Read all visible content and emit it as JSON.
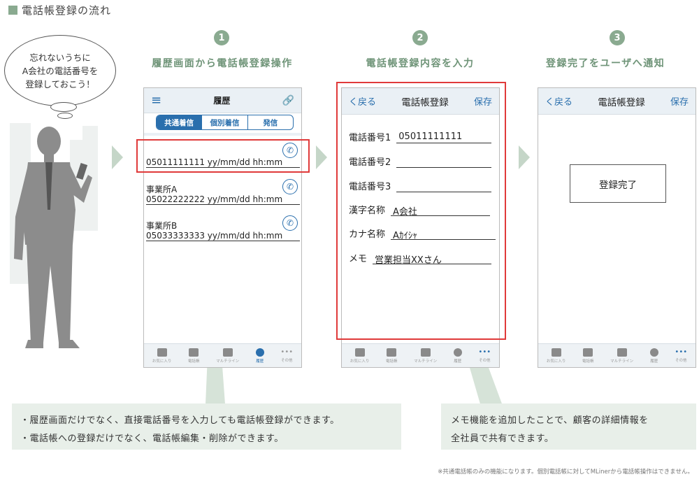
{
  "page_title": "電話帳登録の流れ",
  "bubble_text": [
    "忘れないうちに",
    "A会社の電話番号を",
    "登録しておこう！"
  ],
  "steps": [
    {
      "num": "1",
      "title": "履歴画面から電話帳登録操作"
    },
    {
      "num": "2",
      "title": "電話帳登録内容を入力"
    },
    {
      "num": "3",
      "title": "登録完了をユーザへ通知"
    }
  ],
  "phone1": {
    "header_title": "履歴",
    "menu_icon": "hamburger-menu-icon",
    "link_icon": "link-icon",
    "tabs": [
      "共通着信",
      "個別着信",
      "発信"
    ],
    "history": [
      {
        "name": "",
        "line": "05011111111  yy/mm/dd hh:mm"
      },
      {
        "name": "事業所A",
        "line": "05022222222  yy/mm/dd hh:mm"
      },
      {
        "name": "事業所B",
        "line": "05033333333  yy/mm/dd hh:mm"
      }
    ],
    "footer": [
      "お気に入り",
      "電話帳",
      "マルチライン",
      "履歴",
      "その他"
    ]
  },
  "phone2": {
    "back": "く戻る",
    "title": "電話帳登録",
    "save": "保存",
    "fields": [
      {
        "label": "電話番号1",
        "value": "05011111111"
      },
      {
        "label": "電話番号2",
        "value": ""
      },
      {
        "label": "電話番号3",
        "value": ""
      },
      {
        "label": "漢字名称",
        "value": "A会社"
      },
      {
        "label": "カナ名称",
        "value": "Aｶｲｼｬ"
      },
      {
        "label": "メモ",
        "value": "営業担当XXさん"
      }
    ],
    "footer": [
      "お気に入り",
      "電話帳",
      "マルチライン",
      "履歴",
      "その他"
    ]
  },
  "phone3": {
    "back": "く戻る",
    "title": "電話帳登録",
    "save": "保存",
    "done_message": "登録完了",
    "footer": [
      "お気に入り",
      "電話帳",
      "マルチライン",
      "履歴",
      "その他"
    ]
  },
  "notes": {
    "left": [
      "・履歴画面だけでなく、直接電話番号を入力しても電話帳登録ができます。",
      "・電話帳への登録だけでなく、電話帳編集・削除ができます。"
    ],
    "right": [
      "メモ機能を追加したことで、顧客の詳細情報を",
      "全社員で共有できます。"
    ]
  },
  "footnote": "※共通電話帳のみの機能になります。個別電話帳に対してMLinerから電話帳操作はできません。",
  "colors": {
    "accent_green": "#8aaa90",
    "blue": "#2a6fad",
    "highlight_red": "#e03a3a"
  }
}
